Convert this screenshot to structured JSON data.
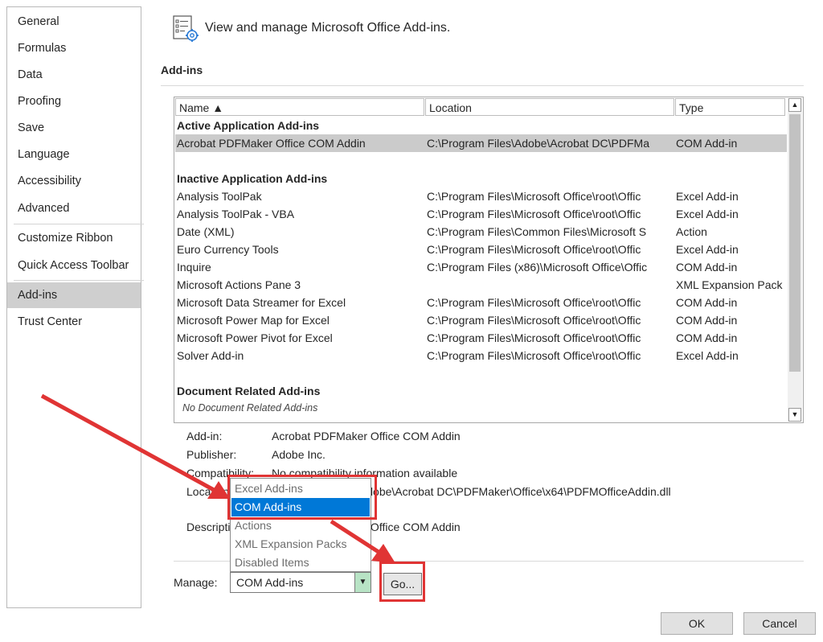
{
  "sidebar": {
    "items": [
      {
        "label": "General"
      },
      {
        "label": "Formulas"
      },
      {
        "label": "Data"
      },
      {
        "label": "Proofing"
      },
      {
        "label": "Save"
      },
      {
        "label": "Language"
      },
      {
        "label": "Accessibility"
      },
      {
        "label": "Advanced"
      },
      {
        "label": "Customize Ribbon"
      },
      {
        "label": "Quick Access Toolbar"
      },
      {
        "label": "Add-ins"
      },
      {
        "label": "Trust Center"
      }
    ],
    "selected": "Add-ins"
  },
  "header": {
    "text": "View and manage Microsoft Office Add-ins.",
    "icon": "addins-manage-icon"
  },
  "section": {
    "title": "Add-ins"
  },
  "table": {
    "columns": [
      "Name ▲",
      "Location",
      "Type"
    ],
    "groups": [
      {
        "title": "Active Application Add-ins",
        "rows": [
          {
            "name": "Acrobat PDFMaker Office COM Addin",
            "location": "C:\\Program Files\\Adobe\\Acrobat DC\\PDFMa",
            "type": "COM Add-in"
          }
        ]
      },
      {
        "title": "Inactive Application Add-ins",
        "rows": [
          {
            "name": "Analysis ToolPak",
            "location": "C:\\Program Files\\Microsoft Office\\root\\Offic",
            "type": "Excel Add-in"
          },
          {
            "name": "Analysis ToolPak - VBA",
            "location": "C:\\Program Files\\Microsoft Office\\root\\Offic",
            "type": "Excel Add-in"
          },
          {
            "name": "Date (XML)",
            "location": "C:\\Program Files\\Common Files\\Microsoft S",
            "type": "Action"
          },
          {
            "name": "Euro Currency Tools",
            "location": "C:\\Program Files\\Microsoft Office\\root\\Offic",
            "type": "Excel Add-in"
          },
          {
            "name": "Inquire",
            "location": "C:\\Program Files (x86)\\Microsoft Office\\Offic",
            "type": "COM Add-in"
          },
          {
            "name": "Microsoft Actions Pane 3",
            "location": "",
            "type": "XML Expansion Pack"
          },
          {
            "name": "Microsoft Data Streamer for Excel",
            "location": "C:\\Program Files\\Microsoft Office\\root\\Offic",
            "type": "COM Add-in"
          },
          {
            "name": "Microsoft Power Map for Excel",
            "location": "C:\\Program Files\\Microsoft Office\\root\\Offic",
            "type": "COM Add-in"
          },
          {
            "name": "Microsoft Power Pivot for Excel",
            "location": "C:\\Program Files\\Microsoft Office\\root\\Offic",
            "type": "COM Add-in"
          },
          {
            "name": "Solver Add-in",
            "location": "C:\\Program Files\\Microsoft Office\\root\\Offic",
            "type": "Excel Add-in"
          }
        ]
      },
      {
        "title": "Document Related Add-ins",
        "note": "No Document Related Add-ins"
      }
    ]
  },
  "details": {
    "addin_label": "Add-in:",
    "addin_value": "Acrobat PDFMaker Office COM Addin",
    "publisher_label": "Publisher:",
    "publisher_value": "Adobe Inc.",
    "compat_label": "Compatibility:",
    "compat_value": "No compatibility information available",
    "location_label": "Location:",
    "location_value": "C:\\Program Files\\Adobe\\Acrobat DC\\PDFMaker\\Office\\x64\\PDFMOfficeAddin.dll",
    "description_label": "Description:",
    "description_value": "Acrobat PDFMaker Office COM Addin"
  },
  "manage": {
    "label": "Manage:",
    "selected": "COM Add-ins",
    "options": [
      "Excel Add-ins",
      "COM Add-ins",
      "Actions",
      "XML Expansion Packs",
      "Disabled Items"
    ],
    "go_label": "Go..."
  },
  "footer": {
    "ok_label": "OK",
    "cancel_label": "Cancel"
  },
  "colors": {
    "annotation": "#e03434",
    "selection": "#0078d7",
    "dropdown_arrow": "#b8e3c5"
  }
}
